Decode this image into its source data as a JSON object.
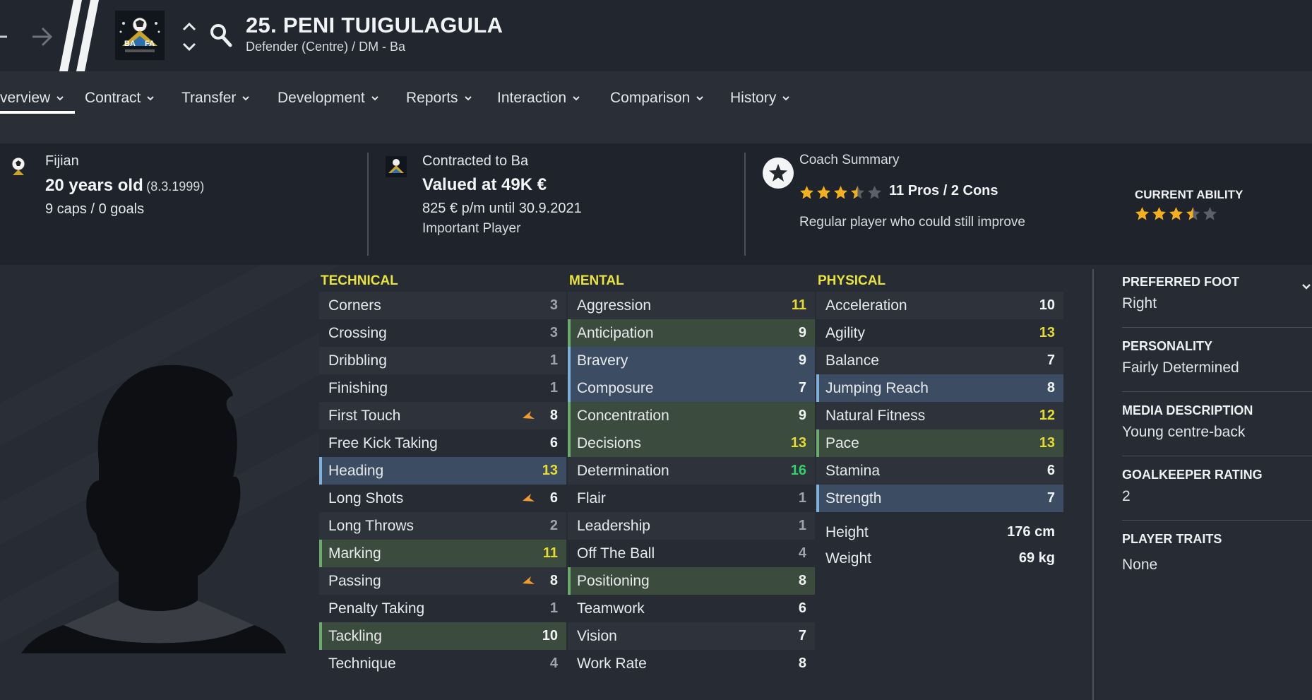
{
  "header": {
    "player_name": "25. PENI TUIGULAGULA",
    "player_subtitle": "Defender (Centre) / DM - Ba",
    "badge_text_left": "BA",
    "badge_text_right": "FA"
  },
  "tabs": [
    {
      "label": "verview"
    },
    {
      "label": "Contract"
    },
    {
      "label": "Transfer"
    },
    {
      "label": "Development"
    },
    {
      "label": "Reports"
    },
    {
      "label": "Interaction"
    },
    {
      "label": "Comparison"
    },
    {
      "label": "History"
    }
  ],
  "info": {
    "nationality": "Fijian",
    "age": "20 years old",
    "dob": "(8.3.1999)",
    "caps": "9 caps / 0 goals",
    "contracted": "Contracted to Ba",
    "value": "Valued at 49K €",
    "wage": "825 € p/m until 30.9.2021",
    "status": "Important Player",
    "coach_title": "Coach Summary",
    "coach_stars": 3.5,
    "pros_cons": "11 Pros / 2 Cons",
    "coach_text": "Regular player who could still improve",
    "ca_label": "CURRENT ABILITY",
    "ca_stars": 3.5
  },
  "attributes": {
    "technical_title": "TECHNICAL",
    "mental_title": "MENTAL",
    "physical_title": "PHYSICAL",
    "technical": [
      {
        "name": "Corners",
        "value": "3"
      },
      {
        "name": "Crossing",
        "value": "3"
      },
      {
        "name": "Dribbling",
        "value": "1"
      },
      {
        "name": "Finishing",
        "value": "1"
      },
      {
        "name": "First Touch",
        "value": "8"
      },
      {
        "name": "Free Kick Taking",
        "value": "6"
      },
      {
        "name": "Heading",
        "value": "13"
      },
      {
        "name": "Long Shots",
        "value": "6"
      },
      {
        "name": "Long Throws",
        "value": "2"
      },
      {
        "name": "Marking",
        "value": "11"
      },
      {
        "name": "Passing",
        "value": "8"
      },
      {
        "name": "Penalty Taking",
        "value": "1"
      },
      {
        "name": "Tackling",
        "value": "10"
      },
      {
        "name": "Technique",
        "value": "4"
      }
    ],
    "mental": [
      {
        "name": "Aggression",
        "value": "11"
      },
      {
        "name": "Anticipation",
        "value": "9"
      },
      {
        "name": "Bravery",
        "value": "9"
      },
      {
        "name": "Composure",
        "value": "7"
      },
      {
        "name": "Concentration",
        "value": "9"
      },
      {
        "name": "Decisions",
        "value": "13"
      },
      {
        "name": "Determination",
        "value": "16"
      },
      {
        "name": "Flair",
        "value": "1"
      },
      {
        "name": "Leadership",
        "value": "1"
      },
      {
        "name": "Off The Ball",
        "value": "4"
      },
      {
        "name": "Positioning",
        "value": "8"
      },
      {
        "name": "Teamwork",
        "value": "6"
      },
      {
        "name": "Vision",
        "value": "7"
      },
      {
        "name": "Work Rate",
        "value": "8"
      }
    ],
    "physical": [
      {
        "name": "Acceleration",
        "value": "10"
      },
      {
        "name": "Agility",
        "value": "13"
      },
      {
        "name": "Balance",
        "value": "7"
      },
      {
        "name": "Jumping Reach",
        "value": "8"
      },
      {
        "name": "Natural Fitness",
        "value": "12"
      },
      {
        "name": "Pace",
        "value": "13"
      },
      {
        "name": "Stamina",
        "value": "6"
      },
      {
        "name": "Strength",
        "value": "7"
      }
    ],
    "height_label": "Height",
    "height_value": "176 cm",
    "weight_label": "Weight",
    "weight_value": "69 kg"
  },
  "side": {
    "preferred_foot_label": "PREFERRED FOOT",
    "preferred_foot": "Right",
    "personality_label": "PERSONALITY",
    "personality": "Fairly Determined",
    "media_label": "MEDIA DESCRIPTION",
    "media": "Young centre-back",
    "gk_label": "GOALKEEPER RATING",
    "gk": "2",
    "traits_label": "PLAYER TRAITS",
    "traits": "None"
  },
  "colors": {
    "accent_yellow": "#e9e33d",
    "highlight_green": "#3b4b3e",
    "highlight_blue": "#3c4d63",
    "star": "#f2b01e"
  }
}
